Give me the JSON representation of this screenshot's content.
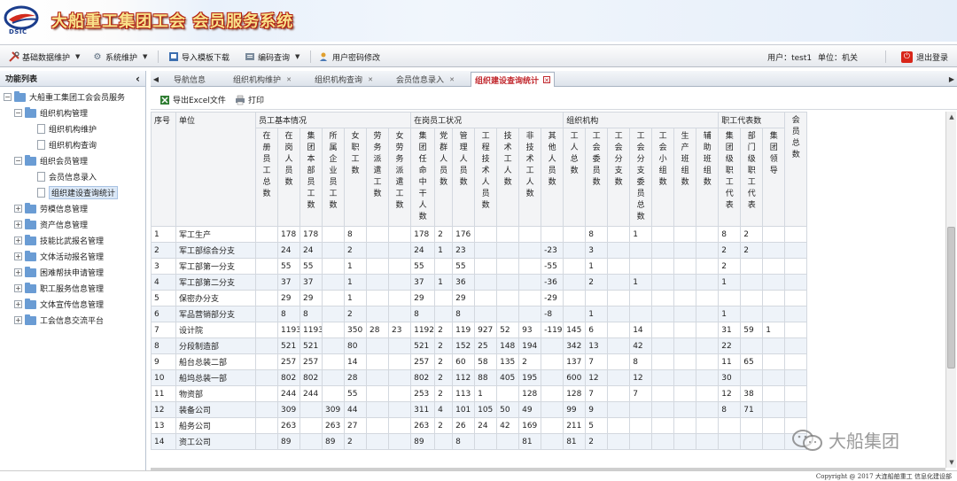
{
  "header": {
    "logo_text": "DSIC",
    "system_title": "大船重工集团工会 会员服务系统"
  },
  "toolbar": {
    "items": [
      {
        "label": "基础数据维护",
        "icon": "tools-icon"
      },
      {
        "label": "系统维护",
        "icon": "gear-icon"
      },
      {
        "label": "导入模板下载",
        "icon": "download-icon"
      },
      {
        "label": "编码查询",
        "icon": "query-icon"
      },
      {
        "label": "用户密码修改",
        "icon": "user-key-icon"
      }
    ],
    "user_label": "用户：test1",
    "unit_label": "单位：机关",
    "logout_label": "退出登录"
  },
  "sidebar": {
    "title": "功能列表",
    "collapse_glyph": "‹",
    "root": "大船重工集团工会会员服务",
    "items": [
      {
        "label": "组织机构管理",
        "level": 1,
        "type": "folder",
        "expanded": true
      },
      {
        "label": "组织机构维护",
        "level": 2,
        "type": "page"
      },
      {
        "label": "组织机构查询",
        "level": 2,
        "type": "page"
      },
      {
        "label": "组织会员管理",
        "level": 1,
        "type": "folder",
        "expanded": true
      },
      {
        "label": "会员信息录入",
        "level": 2,
        "type": "page"
      },
      {
        "label": "组织建设查询统计",
        "level": 2,
        "type": "page",
        "selected": true
      },
      {
        "label": "劳模信息管理",
        "level": 1,
        "type": "folder"
      },
      {
        "label": "资产信息管理",
        "level": 1,
        "type": "folder"
      },
      {
        "label": "技能比武报名管理",
        "level": 1,
        "type": "folder"
      },
      {
        "label": "文体活动报名管理",
        "level": 1,
        "type": "folder"
      },
      {
        "label": "困难帮扶申请管理",
        "level": 1,
        "type": "folder"
      },
      {
        "label": "职工服务信息管理",
        "level": 1,
        "type": "folder"
      },
      {
        "label": "文体宣传信息管理",
        "level": 1,
        "type": "folder"
      },
      {
        "label": "工会信息交流平台",
        "level": 1,
        "type": "folder"
      }
    ]
  },
  "tabs": [
    {
      "label": "导航信息",
      "closable": false
    },
    {
      "label": "组织机构维护",
      "closable": true
    },
    {
      "label": "组织机构查询",
      "closable": true
    },
    {
      "label": "会员信息录入",
      "closable": true
    },
    {
      "label": "组织建设查询统计",
      "closable": true,
      "active": true
    }
  ],
  "subtoolbar": {
    "export_label": "导出Excel文件",
    "print_label": "打印"
  },
  "table": {
    "col_seq": "序号",
    "col_unit": "单位",
    "groups": [
      "员工基本情况",
      "在岗员工状况",
      "组织机构",
      "职工代表数",
      "会员总数"
    ],
    "sub_headers": [
      "在册员工总数",
      "在岗人员数",
      "集团本部员工数",
      "所属企业员工数",
      "女职工数",
      "劳务派遣工数",
      "女劳务派遣工数",
      "集团任命中干人数",
      "党群人员数",
      "管理人员数",
      "工程技术人员数",
      "技术工人数",
      "非技术工人数",
      "其他人员数",
      "工人总数",
      "工会委员数",
      "工会分支数",
      "工会分支委员总数",
      "工会小组数",
      "生产班组数",
      "辅助班组数",
      "集团级职工代表",
      "部门级职工代表",
      "集团领导"
    ],
    "rows": [
      {
        "seq": "1",
        "unit": "军工生产",
        "v": [
          "",
          "178",
          "178",
          "",
          "8",
          "",
          "",
          "178",
          "2",
          "176",
          "",
          "",
          "",
          "",
          "",
          "8",
          "",
          "1",
          "",
          "",
          "",
          "8",
          "2",
          ""
        ]
      },
      {
        "seq": "2",
        "unit": "军工部综合分支",
        "v": [
          "",
          "24",
          "24",
          "",
          "2",
          "",
          "",
          "24",
          "1",
          "23",
          "",
          "",
          "",
          "-23",
          "",
          "3",
          "",
          "",
          "",
          "",
          "",
          "2",
          "2",
          ""
        ]
      },
      {
        "seq": "3",
        "unit": "军工部第一分支",
        "v": [
          "",
          "55",
          "55",
          "",
          "1",
          "",
          "",
          "55",
          "",
          "55",
          "",
          "",
          "",
          "-55",
          "",
          "1",
          "",
          "",
          "",
          "",
          "",
          "2",
          "",
          ""
        ]
      },
      {
        "seq": "4",
        "unit": "军工部第二分支",
        "v": [
          "",
          "37",
          "37",
          "",
          "1",
          "",
          "",
          "37",
          "1",
          "36",
          "",
          "",
          "",
          "-36",
          "",
          "2",
          "",
          "1",
          "",
          "",
          "",
          "1",
          "",
          ""
        ]
      },
      {
        "seq": "5",
        "unit": "保密办分支",
        "v": [
          "",
          "29",
          "29",
          "",
          "1",
          "",
          "",
          "29",
          "",
          "29",
          "",
          "",
          "",
          "-29",
          "",
          "",
          "",
          "",
          "",
          "",
          "",
          "",
          "",
          ""
        ]
      },
      {
        "seq": "6",
        "unit": "军品营销部分支",
        "v": [
          "",
          "8",
          "8",
          "",
          "2",
          "",
          "",
          "8",
          "",
          "8",
          "",
          "",
          "",
          "-8",
          "",
          "1",
          "",
          "",
          "",
          "",
          "",
          "1",
          "",
          ""
        ]
      },
      {
        "seq": "7",
        "unit": "设计院",
        "v": [
          "",
          "1193",
          "1193",
          "",
          "350",
          "28",
          "23",
          "1192",
          "2",
          "119",
          "927",
          "52",
          "93",
          "-1191",
          "145",
          "6",
          "",
          "14",
          "",
          "",
          "",
          "31",
          "59",
          "1"
        ]
      },
      {
        "seq": "8",
        "unit": "分段制造部",
        "v": [
          "",
          "521",
          "521",
          "",
          "80",
          "",
          "",
          "521",
          "2",
          "152",
          "25",
          "148",
          "194",
          "",
          "342",
          "13",
          "",
          "42",
          "",
          "",
          "",
          "22",
          "",
          ""
        ]
      },
      {
        "seq": "9",
        "unit": "船台总装二部",
        "v": [
          "",
          "257",
          "257",
          "",
          "14",
          "",
          "",
          "257",
          "2",
          "60",
          "58",
          "135",
          "2",
          "",
          "137",
          "7",
          "",
          "8",
          "",
          "",
          "",
          "11",
          "65",
          ""
        ]
      },
      {
        "seq": "10",
        "unit": "船坞总装一部",
        "v": [
          "",
          "802",
          "802",
          "",
          "28",
          "",
          "",
          "802",
          "2",
          "112",
          "88",
          "405",
          "195",
          "",
          "600",
          "12",
          "",
          "12",
          "",
          "",
          "",
          "30",
          "",
          ""
        ]
      },
      {
        "seq": "11",
        "unit": "物资部",
        "v": [
          "",
          "244",
          "244",
          "",
          "55",
          "",
          "",
          "253",
          "2",
          "113",
          "1",
          "",
          "128",
          "",
          "128",
          "7",
          "",
          "7",
          "",
          "",
          "",
          "12",
          "38",
          ""
        ]
      },
      {
        "seq": "12",
        "unit": "装备公司",
        "v": [
          "",
          "309",
          "",
          "309",
          "44",
          "",
          "",
          "311",
          "4",
          "101",
          "105",
          "50",
          "49",
          "",
          "99",
          "9",
          "",
          "",
          "",
          "",
          "",
          "8",
          "71",
          ""
        ]
      },
      {
        "seq": "13",
        "unit": "船务公司",
        "v": [
          "",
          "263",
          "",
          "263",
          "27",
          "",
          "",
          "263",
          "2",
          "26",
          "24",
          "42",
          "169",
          "",
          "211",
          "5",
          "",
          "",
          "",
          "",
          "",
          "",
          "",
          ""
        ]
      },
      {
        "seq": "14",
        "unit": "资工公司",
        "v": [
          "",
          "89",
          "",
          "89",
          "2",
          "",
          "",
          "89",
          "",
          "8",
          "",
          "",
          "81",
          "",
          "81",
          "2",
          "",
          "",
          "",
          "",
          "",
          "",
          "",
          ""
        ]
      }
    ]
  },
  "footer": {
    "copyright": "Copyright @ 2017 大连船舶重工 信息化建设部"
  },
  "watermark": {
    "text": "大船集团"
  }
}
